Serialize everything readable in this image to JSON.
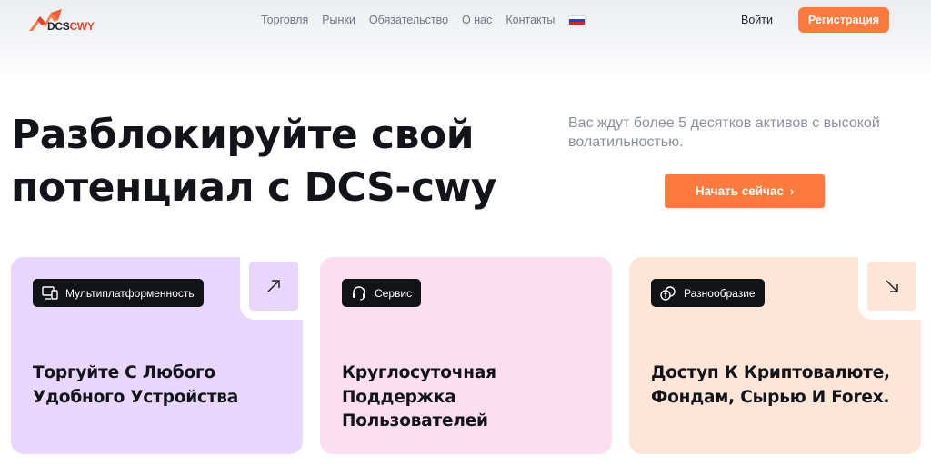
{
  "header": {
    "logo": {
      "text_dark": "DCS",
      "text_red": "CWY"
    },
    "nav": [
      {
        "label": "Торговля"
      },
      {
        "label": "Рынки"
      },
      {
        "label": "Обязательство"
      },
      {
        "label": "О нас"
      },
      {
        "label": "Контакты"
      }
    ],
    "language_flag": "russia-flag-icon",
    "login_label": "Войти",
    "register_label": "Регистрация"
  },
  "hero": {
    "title_line1": "Разблокируйте свой",
    "title_line2": "потенциал с DCS-cwy",
    "subtitle": "Вас ждут более 5 десятков активов с высокой волатильностью.",
    "cta_label": "Начать сейчас"
  },
  "cards": [
    {
      "badge": "Мультиплатформенность",
      "badge_icon": "monitor-icon",
      "title": "Торгуйте С Любого Удобного Устройства",
      "arrow_icon": "arrow-up-right-icon"
    },
    {
      "badge": "Сервис",
      "badge_icon": "headset-icon",
      "title": "Круглосуточная Поддержка Пользователей"
    },
    {
      "badge": "Разнообразие",
      "badge_icon": "coins-icon",
      "title": "Доступ К Криптовалюте, Фондам, Сырью И Forex.",
      "arrow_icon": "arrow-down-right-icon"
    }
  ],
  "colors": {
    "accent": "#ff7a3d",
    "card1": "#e8d6fc",
    "card2": "#fbdff0",
    "card3": "#fde6d8"
  }
}
